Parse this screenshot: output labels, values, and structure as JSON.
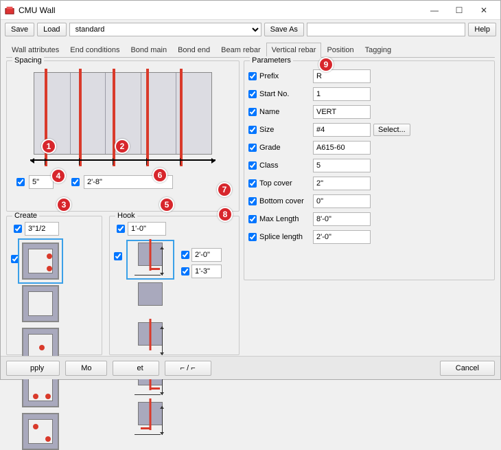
{
  "window": {
    "title": "CMU Wall"
  },
  "toolbar": {
    "save": "Save",
    "load": "Load",
    "preset": "standard",
    "save_as": "Save As",
    "save_as_value": "",
    "help": "Help"
  },
  "tabs": [
    {
      "label": "Wall attributes"
    },
    {
      "label": "End conditions"
    },
    {
      "label": "Bond main"
    },
    {
      "label": "Bond end"
    },
    {
      "label": "Beam rebar"
    },
    {
      "label": "Vertical rebar"
    },
    {
      "label": "Position"
    },
    {
      "label": "Tagging"
    }
  ],
  "active_tab": "Vertical rebar",
  "spacing": {
    "title": "Spacing",
    "offset": "5\"",
    "spacing": "2'-8\""
  },
  "create": {
    "title": "Create",
    "size": "3\"1/2"
  },
  "hook": {
    "title": "Hook",
    "length": "1'-0\"",
    "dim1": "2'-0\"",
    "dim2": "1'-3\""
  },
  "parameters": {
    "title": "Parameters",
    "rows": [
      {
        "label": "Prefix",
        "value": "R"
      },
      {
        "label": "Start No.",
        "value": "1"
      },
      {
        "label": "Name",
        "value": "VERT"
      },
      {
        "label": "Size",
        "value": "#4",
        "button": "Select..."
      },
      {
        "label": "Grade",
        "value": "A615-60"
      },
      {
        "label": "Class",
        "value": "5"
      },
      {
        "label": "Top cover",
        "value": "2\""
      },
      {
        "label": "Bottom cover",
        "value": "0\""
      },
      {
        "label": "Max Length",
        "value": "8'-0\""
      },
      {
        "label": "Splice length",
        "value": "2'-0\""
      }
    ]
  },
  "footer": {
    "apply": "pply",
    "modify": "Mo",
    "et": "et",
    "toggle": "⌐ / ⌐",
    "cancel": "Cancel"
  },
  "badges": {
    "b1": "1",
    "b2": "2",
    "b3": "3",
    "b4": "4",
    "b5": "5",
    "b6": "6",
    "b7": "7",
    "b8": "8",
    "b9": "9"
  }
}
